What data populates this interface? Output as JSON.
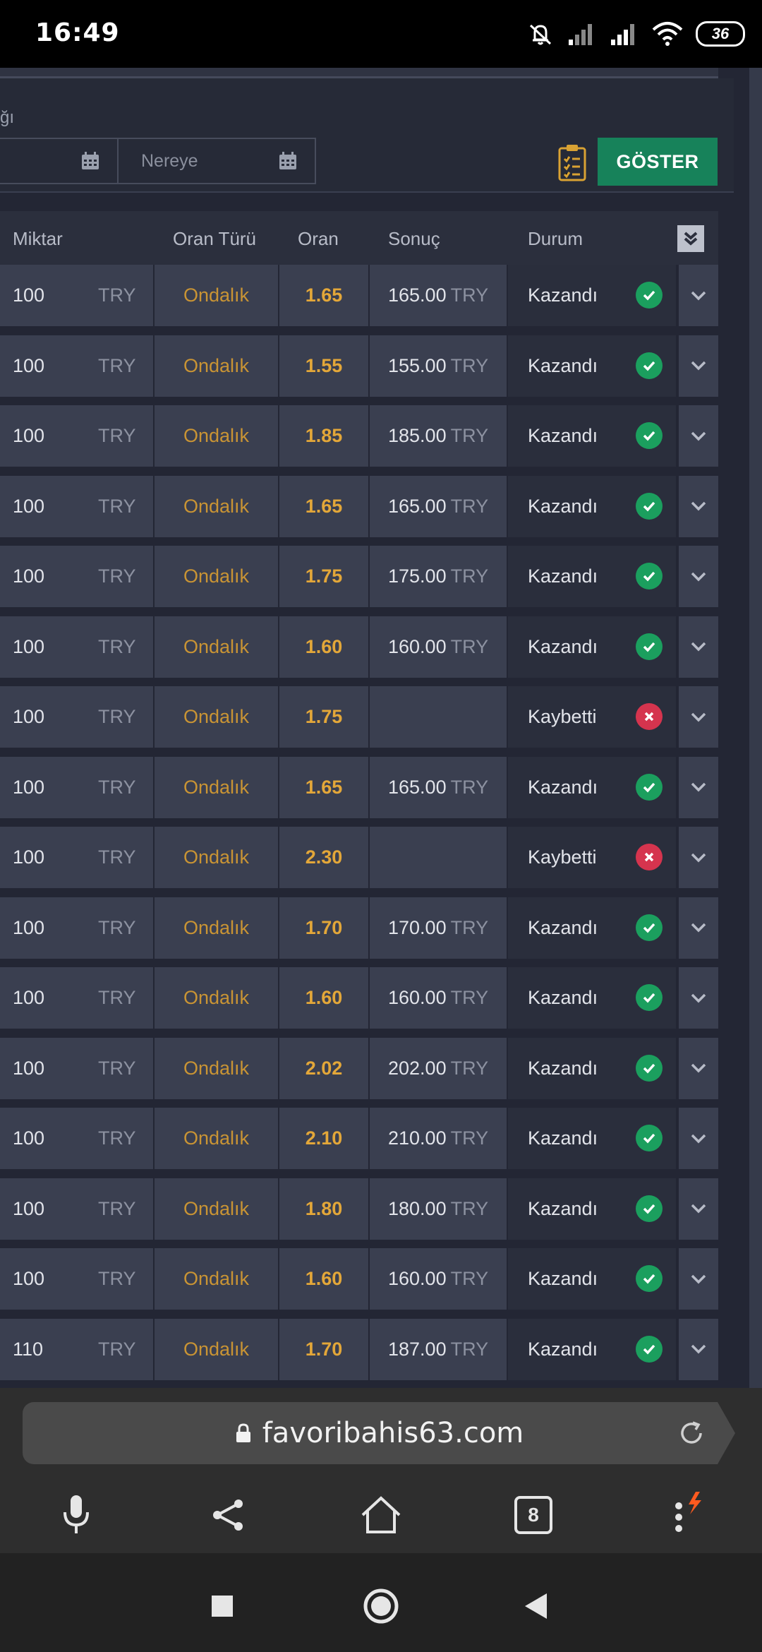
{
  "status_bar": {
    "time": "16:49",
    "battery": "36"
  },
  "filters": {
    "label_fragment": "ğı",
    "from_placeholder": "",
    "to_placeholder": "Nereye",
    "show_button": "GÖSTER"
  },
  "table": {
    "headers": {
      "amount": "Miktar",
      "odds_type": "Oran Türü",
      "odds": "Oran",
      "result": "Sonuç",
      "status": "Durum"
    },
    "rows": [
      {
        "amount": "100",
        "currency": "TRY",
        "odds_type": "Ondalık",
        "odds": "1.65",
        "result": "165.00",
        "result_currency": "TRY",
        "status": "Kazandı",
        "outcome": "win"
      },
      {
        "amount": "100",
        "currency": "TRY",
        "odds_type": "Ondalık",
        "odds": "1.55",
        "result": "155.00",
        "result_currency": "TRY",
        "status": "Kazandı",
        "outcome": "win"
      },
      {
        "amount": "100",
        "currency": "TRY",
        "odds_type": "Ondalık",
        "odds": "1.85",
        "result": "185.00",
        "result_currency": "TRY",
        "status": "Kazandı",
        "outcome": "win"
      },
      {
        "amount": "100",
        "currency": "TRY",
        "odds_type": "Ondalık",
        "odds": "1.65",
        "result": "165.00",
        "result_currency": "TRY",
        "status": "Kazandı",
        "outcome": "win"
      },
      {
        "amount": "100",
        "currency": "TRY",
        "odds_type": "Ondalık",
        "odds": "1.75",
        "result": "175.00",
        "result_currency": "TRY",
        "status": "Kazandı",
        "outcome": "win"
      },
      {
        "amount": "100",
        "currency": "TRY",
        "odds_type": "Ondalık",
        "odds": "1.60",
        "result": "160.00",
        "result_currency": "TRY",
        "status": "Kazandı",
        "outcome": "win"
      },
      {
        "amount": "100",
        "currency": "TRY",
        "odds_type": "Ondalık",
        "odds": "1.75",
        "result": "",
        "result_currency": "",
        "status": "Kaybetti",
        "outcome": "lose"
      },
      {
        "amount": "100",
        "currency": "TRY",
        "odds_type": "Ondalık",
        "odds": "1.65",
        "result": "165.00",
        "result_currency": "TRY",
        "status": "Kazandı",
        "outcome": "win"
      },
      {
        "amount": "100",
        "currency": "TRY",
        "odds_type": "Ondalık",
        "odds": "2.30",
        "result": "",
        "result_currency": "",
        "status": "Kaybetti",
        "outcome": "lose"
      },
      {
        "amount": "100",
        "currency": "TRY",
        "odds_type": "Ondalık",
        "odds": "1.70",
        "result": "170.00",
        "result_currency": "TRY",
        "status": "Kazandı",
        "outcome": "win"
      },
      {
        "amount": "100",
        "currency": "TRY",
        "odds_type": "Ondalık",
        "odds": "1.60",
        "result": "160.00",
        "result_currency": "TRY",
        "status": "Kazandı",
        "outcome": "win"
      },
      {
        "amount": "100",
        "currency": "TRY",
        "odds_type": "Ondalık",
        "odds": "2.02",
        "result": "202.00",
        "result_currency": "TRY",
        "status": "Kazandı",
        "outcome": "win"
      },
      {
        "amount": "100",
        "currency": "TRY",
        "odds_type": "Ondalık",
        "odds": "2.10",
        "result": "210.00",
        "result_currency": "TRY",
        "status": "Kazandı",
        "outcome": "win"
      },
      {
        "amount": "100",
        "currency": "TRY",
        "odds_type": "Ondalık",
        "odds": "1.80",
        "result": "180.00",
        "result_currency": "TRY",
        "status": "Kazandı",
        "outcome": "win"
      },
      {
        "amount": "100",
        "currency": "TRY",
        "odds_type": "Ondalık",
        "odds": "1.60",
        "result": "160.00",
        "result_currency": "TRY",
        "status": "Kazandı",
        "outcome": "win"
      },
      {
        "amount": "110",
        "currency": "TRY",
        "odds_type": "Ondalık",
        "odds": "1.70",
        "result": "187.00",
        "result_currency": "TRY",
        "status": "Kazandı",
        "outcome": "win"
      }
    ]
  },
  "browser": {
    "url": "favoribahis63.com",
    "tab_count": "8"
  },
  "colors": {
    "win": "#1b9f5e",
    "lose": "#d5344e",
    "accent_button": "#17825a",
    "odds": "#e3a739"
  }
}
